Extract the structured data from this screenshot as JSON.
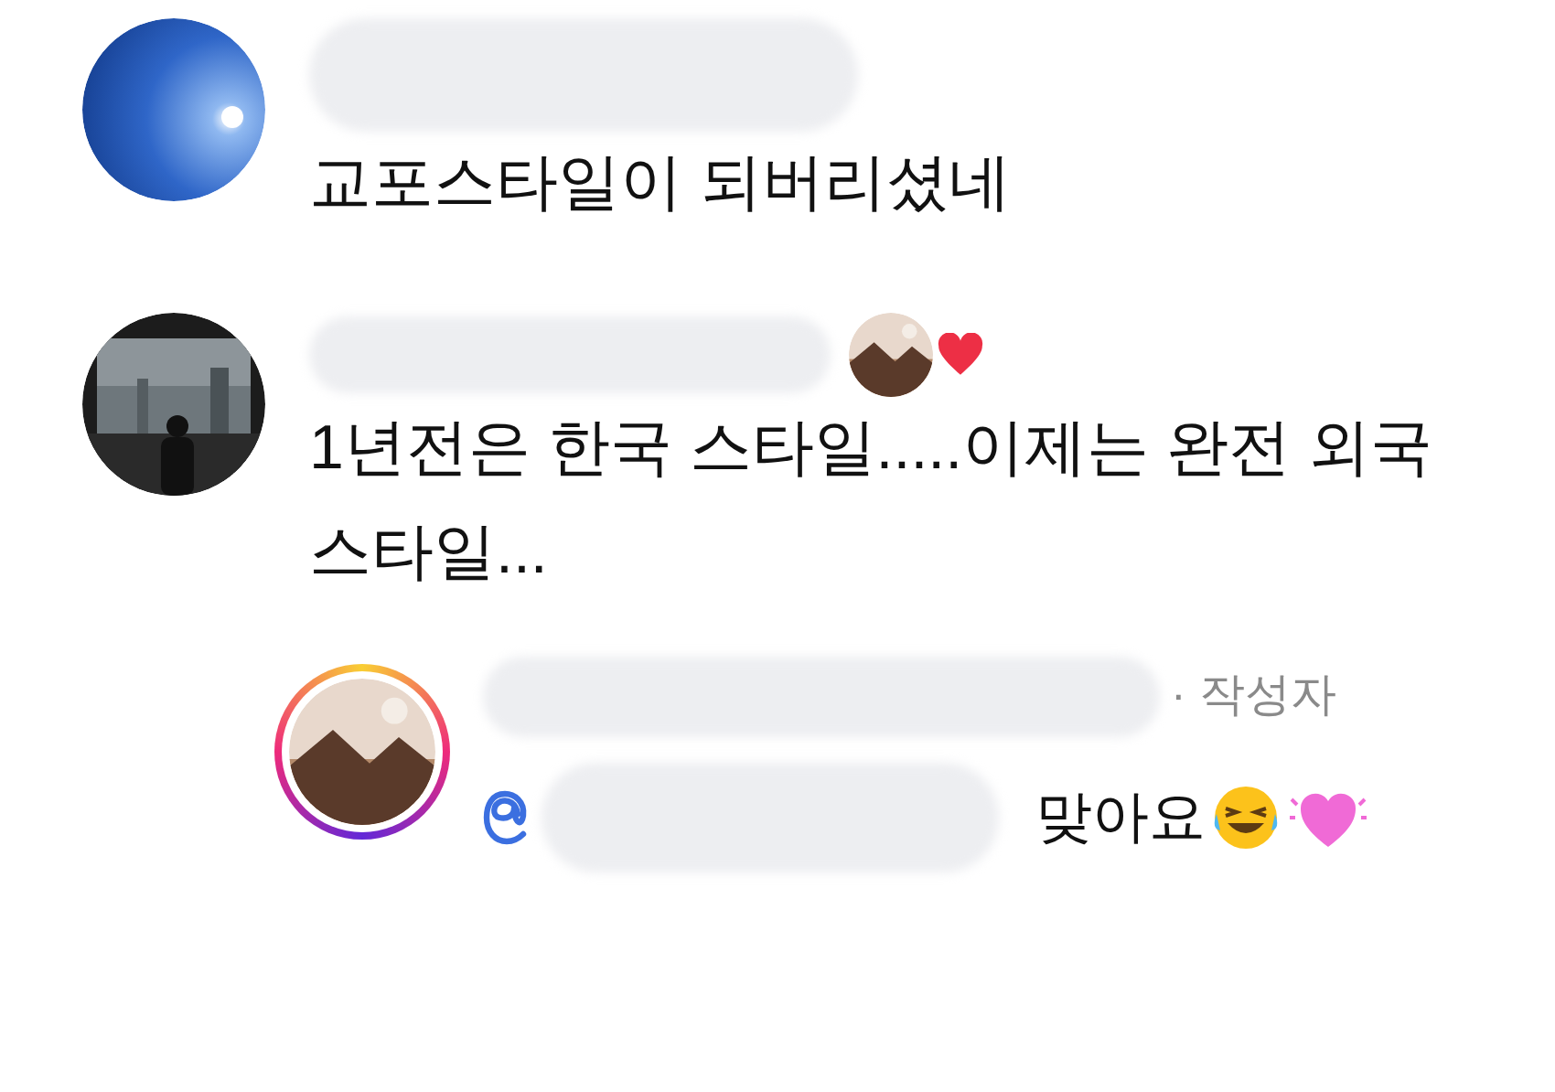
{
  "comments": [
    {
      "text": "교포스타일이 되버리셨네",
      "author_liked": false
    },
    {
      "text": "1년전은 한국 스타일.....이제는 완전 외국 스타일...",
      "author_liked": true
    }
  ],
  "reply": {
    "badge": "· 작성자",
    "mention": true,
    "text": "맞아요"
  }
}
